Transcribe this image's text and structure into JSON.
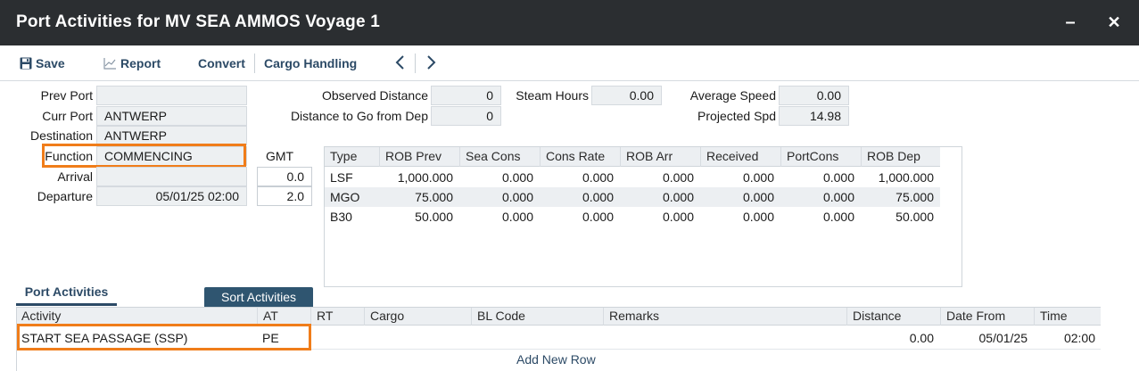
{
  "window": {
    "title": "Port Activities for MV SEA AMMOS Voyage 1",
    "minimize_label": "–",
    "close_label": "✕"
  },
  "toolbar": {
    "save_label": "Save",
    "report_label": "Report",
    "convert_label": "Convert",
    "cargo_handling_label": "Cargo Handling"
  },
  "port_info": {
    "prev_port_label": "Prev Port",
    "prev_port_value": "",
    "curr_port_label": "Curr Port",
    "curr_port_value": "ANTWERP",
    "destination_label": "Destination",
    "destination_value": "ANTWERP",
    "function_label": "Function",
    "function_value": "COMMENCING",
    "arrival_label": "Arrival",
    "arrival_value": "",
    "departure_label": "Departure",
    "departure_value": "05/01/25 02:00",
    "gmt_label": "GMT",
    "gmt_arrival": "0.0",
    "gmt_departure": "2.0"
  },
  "distance_info": {
    "observed_distance_label": "Observed Distance",
    "observed_distance_value": "0",
    "distance_to_go_label": "Distance to Go from Dep",
    "distance_to_go_value": "0",
    "steam_hours_label": "Steam Hours",
    "steam_hours_value": "0.00",
    "average_speed_label": "Average Speed",
    "average_speed_value": "0.00",
    "projected_spd_label": "Projected Spd",
    "projected_spd_value": "14.98"
  },
  "rob_table": {
    "headers": [
      "Type",
      "ROB Prev",
      "Sea Cons",
      "Cons Rate",
      "ROB Arr",
      "Received",
      "PortCons",
      "ROB Dep"
    ],
    "rows": [
      [
        "LSF",
        "1,000.000",
        "0.000",
        "0.000",
        "0.000",
        "0.000",
        "0.000",
        "1,000.000"
      ],
      [
        "MGO",
        "75.000",
        "0.000",
        "0.000",
        "0.000",
        "0.000",
        "0.000",
        "75.000"
      ],
      [
        "B30",
        "50.000",
        "0.000",
        "0.000",
        "0.000",
        "0.000",
        "0.000",
        "50.000"
      ]
    ]
  },
  "activities": {
    "tab_label": "Port Activities",
    "sort_button_label": "Sort Activities",
    "headers": [
      "Activity",
      "AT",
      "RT",
      "Cargo",
      "BL Code",
      "Remarks",
      "Distance",
      "Date From",
      "Time"
    ],
    "rows": [
      {
        "activity": "START SEA PASSAGE (SSP)",
        "at": "PE",
        "rt": "",
        "cargo": "",
        "bl_code": "",
        "remarks": "",
        "distance": "0.00",
        "date_from": "05/01/25",
        "time": "02:00"
      }
    ],
    "add_row_label": "Add New Row"
  },
  "colors": {
    "titlebar": "#2b2e31",
    "accent": "#2c4a66",
    "highlight": "#f07d1a",
    "field_bg": "#edf0f2"
  }
}
